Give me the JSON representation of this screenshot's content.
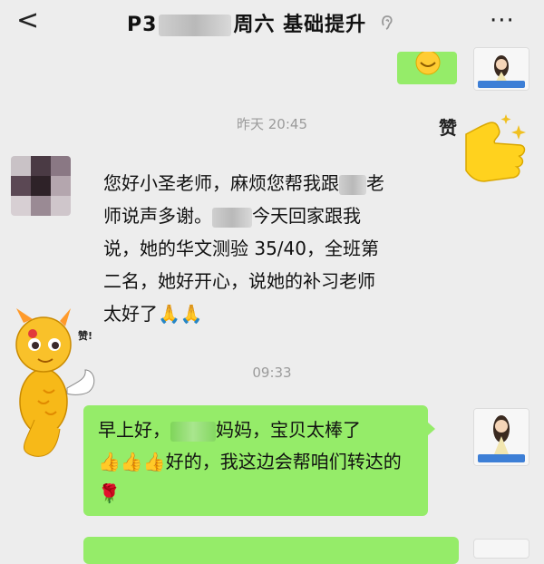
{
  "header": {
    "back_label": "<",
    "title_prefix": "P3",
    "title_suffix": "周六 基础提升",
    "more_label": "···"
  },
  "messages": {
    "time1": "昨天 20:45",
    "incoming": {
      "part1": "您好小圣老师，麻烦您帮我跟",
      "part2": "老师说声多谢。",
      "part3": "今天回家跟我说，她的华文测验 35/40，全班第二名，她好开心，说她的补习老师太好了",
      "emoji": "🙏🙏"
    },
    "time2": "09:33",
    "outgoing": {
      "part1": "早上好，",
      "part2": "妈妈，宝贝太棒了",
      "thumbs": "👍👍👍",
      "part3": "好的，我这边会帮咱们转达的",
      "rose": "🌹"
    }
  },
  "stickers": {
    "zan_text": "赞",
    "dragon_zan": "赞!"
  }
}
